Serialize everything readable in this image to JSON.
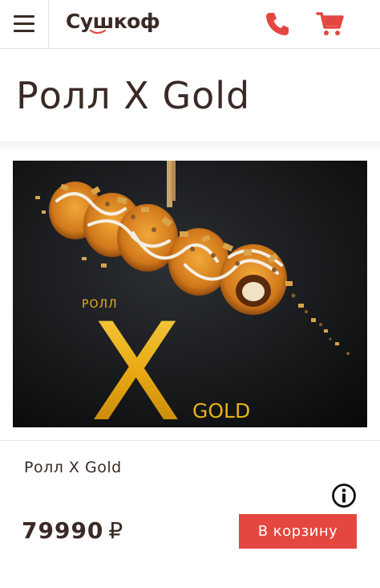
{
  "header": {
    "logo_text": "Сушкоф",
    "menu_icon": "hamburger-menu-icon",
    "phone_icon": "phone-icon",
    "cart_icon": "shopping-cart-icon"
  },
  "page": {
    "title": "Ролл X Gold"
  },
  "product": {
    "image": {
      "brand_small": "РОЛЛ",
      "brand_big": "X",
      "brand_suffix": "GOLD"
    },
    "name": "Ролл X Gold",
    "info_icon": "info-icon",
    "price": "79990",
    "currency": "₽",
    "add_button_label": "В корзину"
  },
  "colors": {
    "accent": "#e4473f",
    "text": "#3a2a26",
    "gold": "#e8b21a",
    "image_bg": "#0f1113"
  }
}
